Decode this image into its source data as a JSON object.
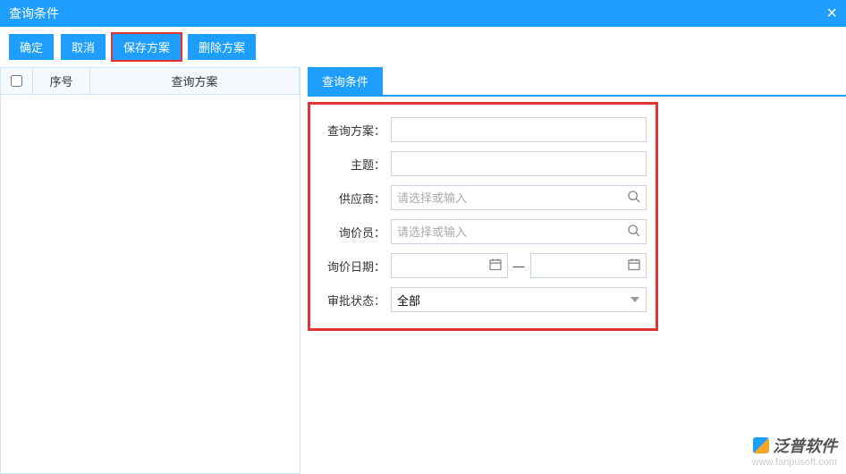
{
  "title": "查询条件",
  "toolbar": {
    "confirm": "确定",
    "cancel": "取消",
    "save_plan": "保存方案",
    "delete_plan": "删除方案"
  },
  "left_table": {
    "headers": {
      "num": "序号",
      "plan": "查询方案"
    },
    "rows": []
  },
  "tab": {
    "label": "查询条件"
  },
  "form": {
    "plan_label": "查询方案：",
    "plan_value": "",
    "subject_label": "主题：",
    "subject_value": "",
    "vendor_label": "供应商：",
    "vendor_placeholder": "请选择或输入",
    "inquirer_label": "询价员：",
    "inquirer_placeholder": "请选择或输入",
    "date_label": "询价日期：",
    "date_from": "",
    "date_to": "",
    "date_sep": "—",
    "status_label": "审批状态：",
    "status_value": "全部"
  },
  "footer": {
    "brand": "泛普软件",
    "url": "www.fanpusoft.com"
  }
}
